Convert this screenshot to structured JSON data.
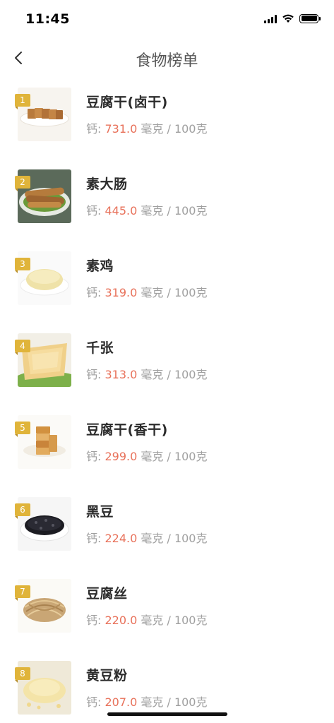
{
  "status_bar": {
    "time": "11:45"
  },
  "nav": {
    "title": "食物榜单",
    "back_icon": "chevron-left-icon"
  },
  "nutrient_label": "钙: ",
  "unit_label": " 毫克 / 100克",
  "colors": {
    "rank_badge": "#e0b43a",
    "value": "#e8715a",
    "meta": "#a0a0a0"
  },
  "items": [
    {
      "rank": "1",
      "name": "豆腐干(卤干)",
      "value": "731.0",
      "image": "braised-tofu"
    },
    {
      "rank": "2",
      "name": "素大肠",
      "value": "445.0",
      "image": "vegetarian-intestine"
    },
    {
      "rank": "3",
      "name": "素鸡",
      "value": "319.0",
      "image": "vegetarian-chicken"
    },
    {
      "rank": "4",
      "name": "千张",
      "value": "313.0",
      "image": "tofu-skin"
    },
    {
      "rank": "5",
      "name": "豆腐干(香干)",
      "value": "299.0",
      "image": "smoked-tofu"
    },
    {
      "rank": "6",
      "name": "黑豆",
      "value": "224.0",
      "image": "black-beans"
    },
    {
      "rank": "7",
      "name": "豆腐丝",
      "value": "220.0",
      "image": "tofu-shreds"
    },
    {
      "rank": "8",
      "name": "黄豆粉",
      "value": "207.0",
      "image": "soybean-flour"
    }
  ]
}
